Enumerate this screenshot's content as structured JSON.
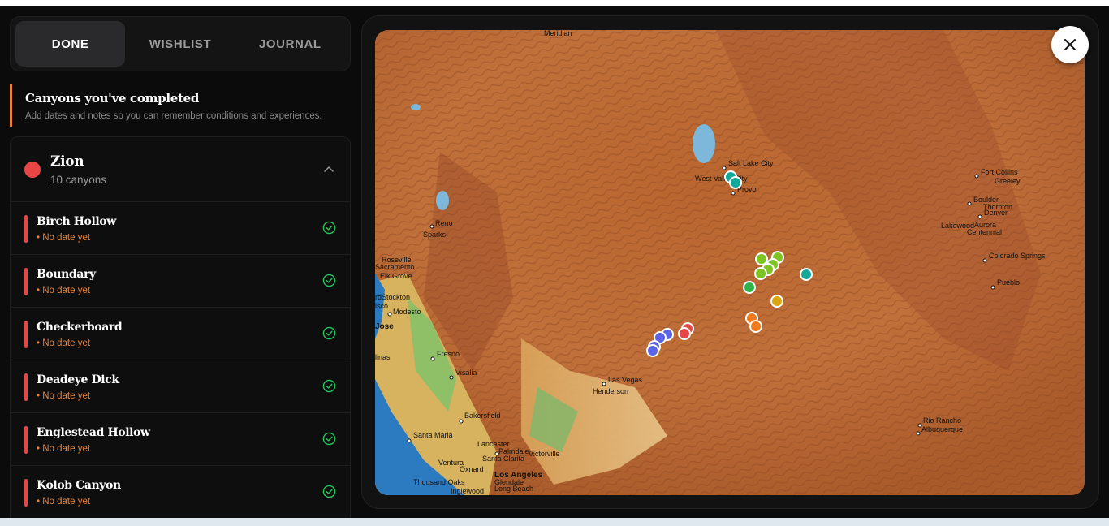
{
  "tabs": [
    {
      "label": "DONE",
      "active": true
    },
    {
      "label": "WISHLIST",
      "active": false
    },
    {
      "label": "JOURNAL",
      "active": false
    }
  ],
  "section": {
    "title": "Canyons you've completed",
    "subtitle": "Add dates and notes so you can remember conditions and experiences."
  },
  "group": {
    "name": "Zion",
    "count": "10 canyons",
    "color": "#e84545"
  },
  "canyons": [
    {
      "name": "Birch Hollow",
      "date": "• No date yet"
    },
    {
      "name": "Boundary",
      "date": "• No date yet"
    },
    {
      "name": "Checkerboard",
      "date": "• No date yet"
    },
    {
      "name": "Deadeye Dick",
      "date": "• No date yet"
    },
    {
      "name": "Englestead Hollow",
      "date": "• No date yet"
    },
    {
      "name": "Kolob Canyon",
      "date": "• No date yet"
    }
  ],
  "map": {
    "close_icon": "close-icon",
    "cities": [
      "Meridian",
      "Salt Lake City",
      "West Valley City",
      "Provo",
      "Fort Collins",
      "Greeley",
      "Boulder",
      "Thornton",
      "Denver",
      "Lakewood",
      "Aurora",
      "Centennial",
      "Colorado Springs",
      "Pueblo",
      "Reno",
      "Sparks",
      "Roseville",
      "Sacramento",
      "Elk Grove",
      "Stockton",
      "Modesto",
      "San Jose",
      "Fresno",
      "Visalia",
      "Las Vegas",
      "Henderson",
      "Bakersfield",
      "Santa Maria",
      "Lancaster",
      "Palmdale",
      "Victorville",
      "Santa Clarita",
      "Ventura",
      "Oxnard",
      "Los Angeles",
      "Thousand Oaks",
      "Glendale",
      "Long Beach",
      "Inglewood",
      "Rio Rancho",
      "Albuquerque"
    ],
    "marker_colors": {
      "zion": "#e84545",
      "blue": "#5b63e8",
      "green": "#2db34a",
      "lime": "#7cc421",
      "teal": "#14a89a",
      "orange": "#ee7a1d",
      "amber": "#dca512"
    }
  }
}
